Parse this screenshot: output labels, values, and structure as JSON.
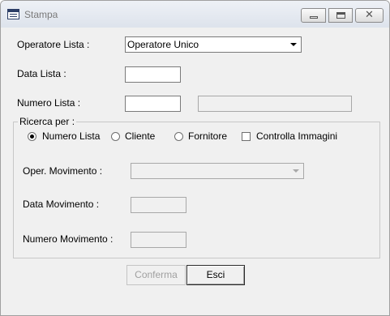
{
  "window": {
    "title": "Stampa"
  },
  "form": {
    "operatore_lista_label": "Operatore Lista :",
    "operatore_lista_value": "Operatore Unico",
    "data_lista_label": "Data Lista :",
    "numero_lista_label": "Numero Lista :",
    "ricerca_caption": "Ricerca per :",
    "radio_numero_lista": "Numero Lista",
    "radio_cliente": "Cliente",
    "radio_fornitore": "Fornitore",
    "check_controlla_immagini": "Controlla Immagini",
    "oper_movimento_label": "Oper. Movimento :",
    "data_movimento_label": "Data Movimento :",
    "numero_movimento_label": "Numero Movimento :"
  },
  "buttons": {
    "conferma": "Conferma",
    "esci": "Esci"
  }
}
